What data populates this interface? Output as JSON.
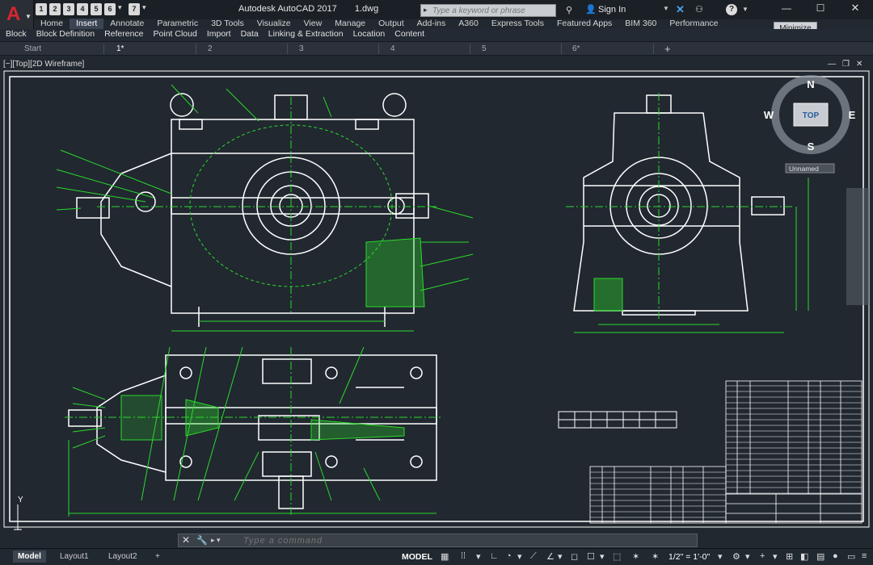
{
  "app": {
    "logo_letter": "A",
    "title": "Autodesk AutoCAD 2017",
    "filename": "1.dwg",
    "qat_buttons": [
      "1",
      "2",
      "3",
      "4",
      "5",
      "6",
      "7"
    ],
    "search_placeholder": "Type a keyword or phrase",
    "signin_label": "Sign In",
    "minimize_tooltip": "Minimize"
  },
  "ribbon": {
    "tabs": [
      "Home",
      "Insert",
      "Annotate",
      "Parametric",
      "3D Tools",
      "Visualize",
      "View",
      "Manage",
      "Output",
      "Add-ins",
      "A360",
      "Express Tools",
      "Featured Apps",
      "BIM 360",
      "Performance"
    ],
    "active_tab": "Insert",
    "panels": [
      "Block",
      "Block Definition",
      "Reference",
      "Point Cloud",
      "Import",
      "Data",
      "Linking & Extraction",
      "Location",
      "Content"
    ]
  },
  "file_tabs": [
    "Start",
    "1*",
    "2",
    "3",
    "4",
    "5",
    "6*"
  ],
  "viewport": {
    "label": "[−][Top][2D Wireframe]"
  },
  "viewcube": {
    "north": "N",
    "south": "S",
    "east": "E",
    "west": "W",
    "face": "TOP",
    "ucs_label": "Unnamed"
  },
  "command_line": {
    "placeholder": "Type a command"
  },
  "layout_tabs": [
    "Model",
    "Layout1",
    "Layout2"
  ],
  "status": {
    "space": "MODEL",
    "scale": "1/2\" = 1'-0\""
  },
  "colors": {
    "background": "#212830",
    "drawing_bg": "#212830",
    "lines_white": "#ffffff",
    "lines_green": "#2bd92b",
    "accent_red": "#d9262c",
    "active_tab": "#3b4453"
  }
}
